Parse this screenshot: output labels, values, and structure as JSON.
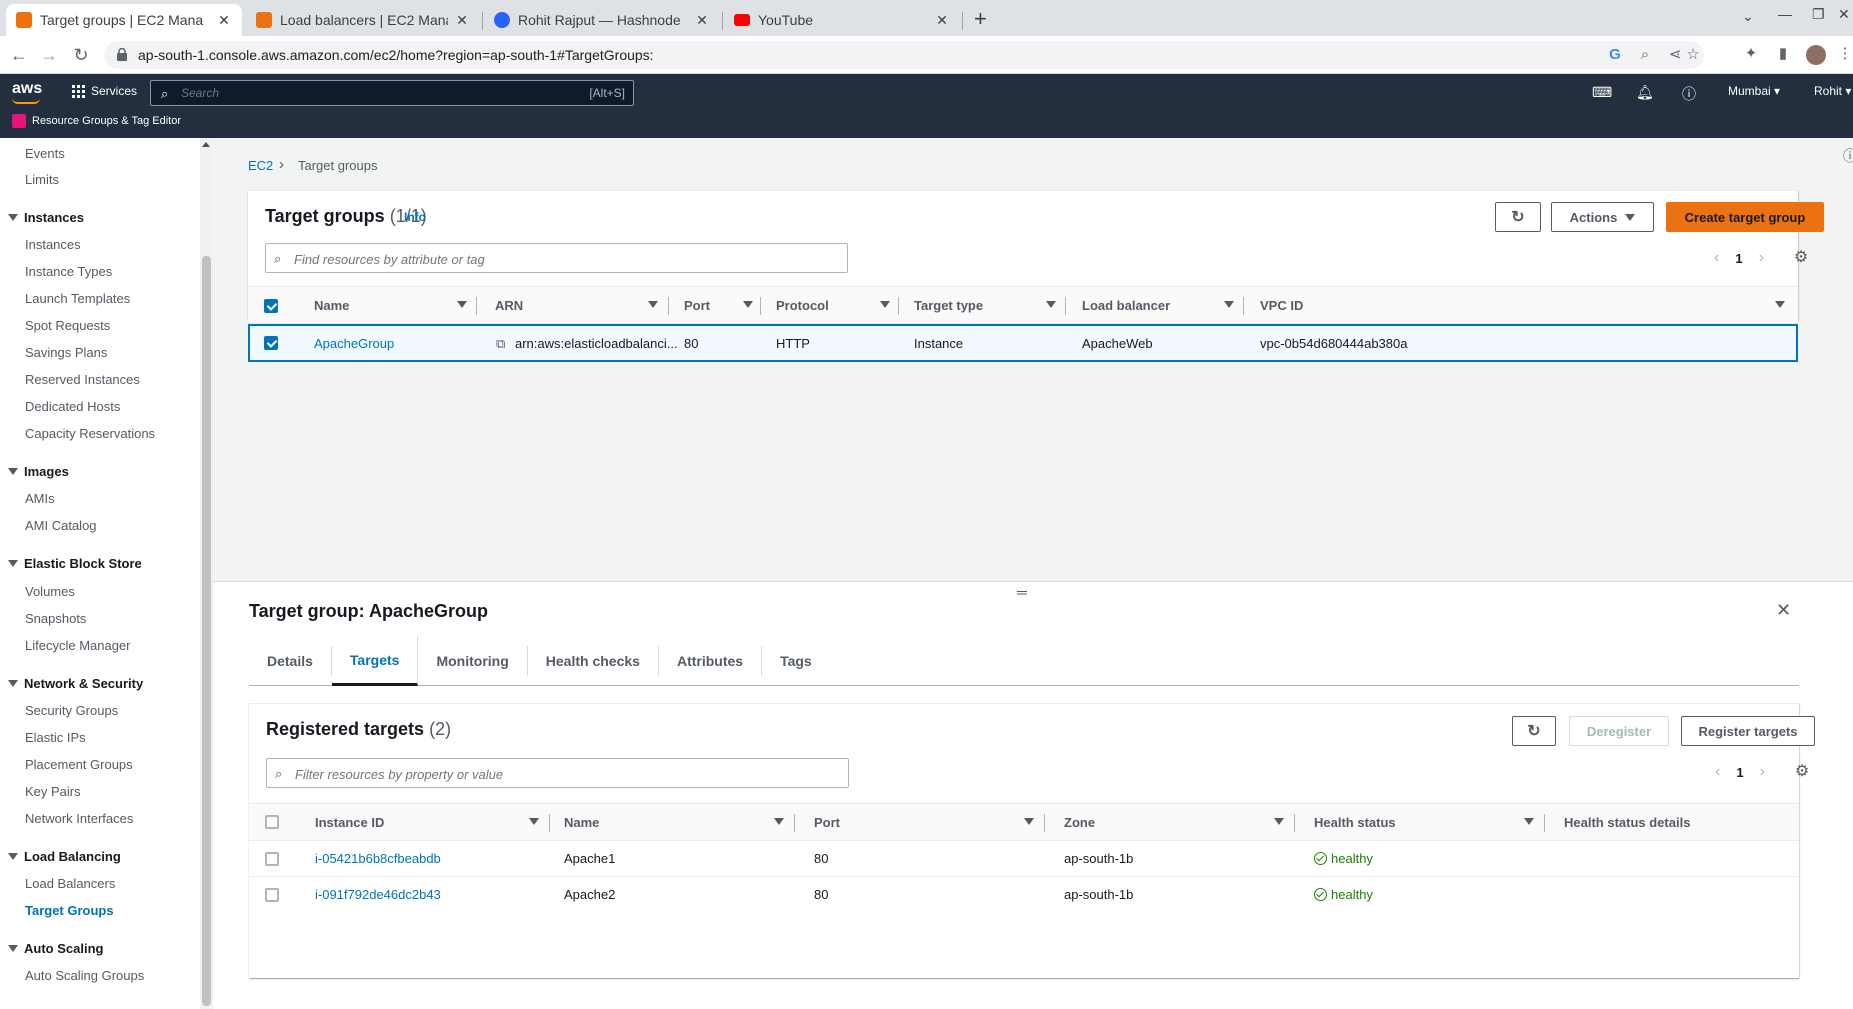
{
  "browser": {
    "tabs": [
      {
        "title": "Target groups | EC2 Mana",
        "favicon_color": "#ec7211",
        "active": true
      },
      {
        "title": "Load balancers | EC2 Mana",
        "favicon_color": "#ec7211",
        "active": false
      },
      {
        "title": "Rohit Rajput — Hashnode",
        "favicon_color": "#2962ff",
        "active": false
      },
      {
        "title": "YouTube",
        "favicon_color": "#ff0000",
        "active": false
      }
    ],
    "url": "ap-south-1.console.aws.amazon.com/ec2/home?region=ap-south-1#TargetGroups:"
  },
  "aws_header": {
    "logo": "aws",
    "services_label": "Services",
    "search_placeholder": "Search",
    "search_shortcut": "[Alt+S]",
    "region": "Mumbai ▾",
    "user": "Rohit ▾",
    "resource_groups": "Resource Groups & Tag Editor"
  },
  "sidebar": {
    "top_items": [
      "Events",
      "Limits"
    ],
    "sections": [
      {
        "title": "Instances",
        "items": [
          "Instances",
          "Instance Types",
          "Launch Templates",
          "Spot Requests",
          "Savings Plans",
          "Reserved Instances",
          "Dedicated Hosts",
          "Capacity Reservations"
        ]
      },
      {
        "title": "Images",
        "items": [
          "AMIs",
          "AMI Catalog"
        ]
      },
      {
        "title": "Elastic Block Store",
        "items": [
          "Volumes",
          "Snapshots",
          "Lifecycle Manager"
        ]
      },
      {
        "title": "Network & Security",
        "items": [
          "Security Groups",
          "Elastic IPs",
          "Placement Groups",
          "Key Pairs",
          "Network Interfaces"
        ]
      },
      {
        "title": "Load Balancing",
        "items": [
          "Load Balancers",
          "Target Groups"
        ]
      },
      {
        "title": "Auto Scaling",
        "items": [
          "Auto Scaling Groups"
        ]
      }
    ],
    "active_item": "Target Groups"
  },
  "breadcrumb": {
    "root": "EC2",
    "current": "Target groups"
  },
  "target_groups": {
    "title": "Target groups",
    "count": "(1/1)",
    "info": "Info",
    "actions_label": "Actions",
    "create_label": "Create target group",
    "filter_placeholder": "Find resources by attribute or tag",
    "page": "1",
    "columns": [
      "Name",
      "ARN",
      "Port",
      "Protocol",
      "Target type",
      "Load balancer",
      "VPC ID"
    ],
    "rows": [
      {
        "name": "ApacheGroup",
        "arn": "arn:aws:elasticloadbalanci...",
        "port": "80",
        "protocol": "HTTP",
        "target_type": "Instance",
        "load_balancer": "ApacheWeb",
        "vpc_id": "vpc-0b54d680444ab380a"
      }
    ]
  },
  "detail": {
    "title": "Target group: ApacheGroup",
    "tabs": [
      "Details",
      "Targets",
      "Monitoring",
      "Health checks",
      "Attributes",
      "Tags"
    ],
    "active_tab": "Targets",
    "registered": {
      "title": "Registered targets",
      "count": "(2)",
      "deregister_label": "Deregister",
      "register_label": "Register targets",
      "filter_placeholder": "Filter resources by property or value",
      "page": "1",
      "columns": [
        "Instance ID",
        "Name",
        "Port",
        "Zone",
        "Health status",
        "Health status details"
      ],
      "rows": [
        {
          "instance_id": "i-05421b6b8cfbeabdb",
          "name": "Apache1",
          "port": "80",
          "zone": "ap-south-1b",
          "health": "healthy",
          "details": ""
        },
        {
          "instance_id": "i-091f792de46dc2b43",
          "name": "Apache2",
          "port": "80",
          "zone": "ap-south-1b",
          "health": "healthy",
          "details": ""
        }
      ]
    }
  }
}
